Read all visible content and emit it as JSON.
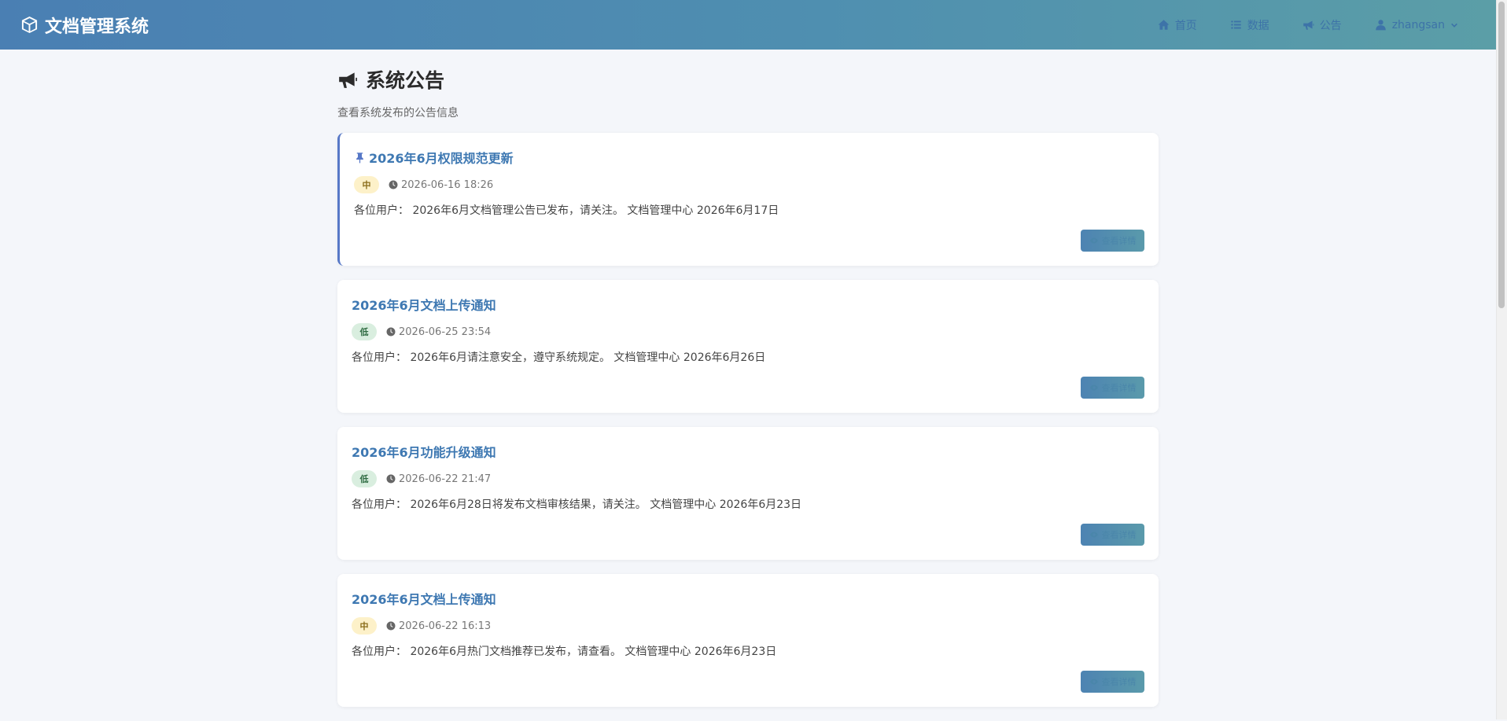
{
  "header": {
    "brand": "文档管理系统",
    "nav": {
      "home": "首页",
      "data": "数据",
      "announce": "公告",
      "user": "zhangsan"
    }
  },
  "page": {
    "title": "系统公告",
    "subtitle": "查看系统发布的公告信息"
  },
  "announcements": [
    {
      "title": "2026年6月权限规范更新",
      "pinned": true,
      "priority": "中",
      "time": "2026-06-16 18:26",
      "content": "各位用户： 2026年6月文档管理公告已发布，请关注。 文档管理中心 2026年6月17日",
      "button": "查看详情"
    },
    {
      "title": "2026年6月文档上传通知",
      "pinned": false,
      "priority": "低",
      "time": "2026-06-25 23:54",
      "content": "各位用户： 2026年6月请注意安全，遵守系统规定。 文档管理中心 2026年6月26日",
      "button": "查看详情"
    },
    {
      "title": "2026年6月功能升级通知",
      "pinned": false,
      "priority": "低",
      "time": "2026-06-22 21:47",
      "content": "各位用户： 2026年6月28日将发布文档审核结果，请关注。 文档管理中心 2026年6月23日",
      "button": "查看详情"
    },
    {
      "title": "2026年6月文档上传通知",
      "pinned": false,
      "priority": "中",
      "time": "2026-06-22 16:13",
      "content": "各位用户： 2026年6月热门文档推荐已发布，请查看。 文档管理中心 2026年6月23日",
      "button": "查看详情"
    }
  ],
  "colors": {
    "header_start": "#4a7fb3",
    "header_end": "#5b9ea7",
    "title_blue": "#3e78b2",
    "pinned_accent": "#5778c7",
    "badge_mid_bg": "#fdf1c9",
    "badge_low_bg": "#d9eedf"
  }
}
